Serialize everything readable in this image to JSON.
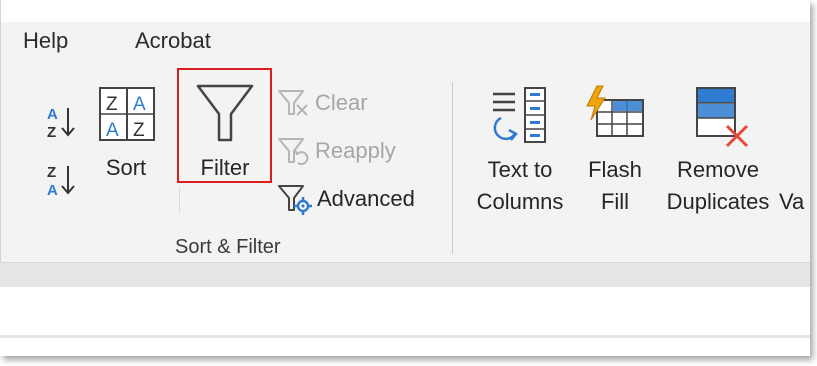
{
  "menu": {
    "help": "Help",
    "acrobat": "Acrobat"
  },
  "sort_filter": {
    "sort_az_icon": "sort-ascending-icon",
    "sort_za_icon": "sort-descending-icon",
    "sort_label": "Sort",
    "filter_label": "Filter",
    "clear_label": "Clear",
    "reapply_label": "Reapply",
    "advanced_label": "Advanced",
    "group_label": "Sort & Filter"
  },
  "data_tools": {
    "text_to_columns_line1": "Text to",
    "text_to_columns_line2": "Columns",
    "flash_fill_line1": "Flash",
    "flash_fill_line2": "Fill",
    "remove_duplicates_line1": "Remove",
    "remove_duplicates_line2": "Duplicates",
    "data_validation_partial": "Va"
  },
  "colors": {
    "accent_blue": "#2e7bcf",
    "highlight_red": "#d81e1e",
    "flash_orange": "#f0a30a",
    "remove_red": "#e24b3b",
    "disabled_gray": "#a6a6a6"
  }
}
